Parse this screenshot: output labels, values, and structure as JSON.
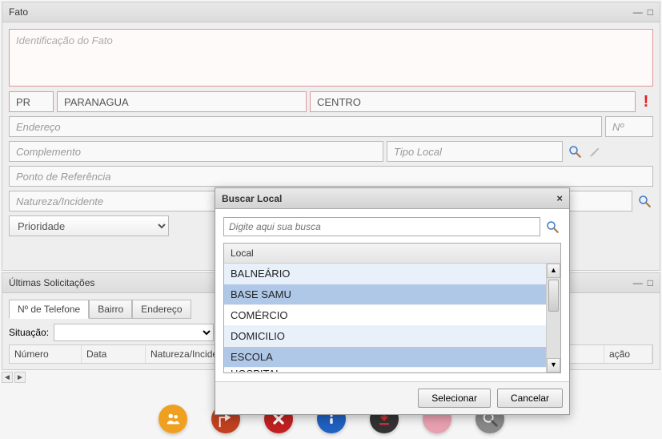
{
  "fato": {
    "title": "Fato",
    "id_placeholder": "Identificação do Fato",
    "uf": "PR",
    "city": "PARANAGUA",
    "district": "CENTRO",
    "endereco_placeholder": "Endereço",
    "numero_placeholder": "Nº",
    "complemento_placeholder": "Complemento",
    "tipo_local_placeholder": "Tipo Local",
    "referencia_placeholder": "Ponto de Referência",
    "natureza_placeholder": "Natureza/Incidente",
    "prioridade_label": "Prioridade"
  },
  "ultimas": {
    "title": "Últimas Solicitações",
    "tabs": {
      "telefone": "Nº de Telefone",
      "bairro": "Bairro",
      "endereco": "Endereço"
    },
    "situacao_label": "Situação:",
    "cols": {
      "numero": "Número",
      "data": "Data",
      "natureza": "Natureza/Incidente",
      "acao": "ação"
    }
  },
  "modal": {
    "title": "Buscar Local",
    "search_placeholder": "Digite aqui sua busca",
    "list_header": "Local",
    "items": [
      "BALNEÁRIO",
      "BASE SAMU",
      "COMÉRCIO",
      "DOMICILIO",
      "ESCOLA",
      "HOSPITAL"
    ],
    "selected": "BASE SAMU",
    "select_btn": "Selecionar",
    "cancel_btn": "Cancelar"
  }
}
